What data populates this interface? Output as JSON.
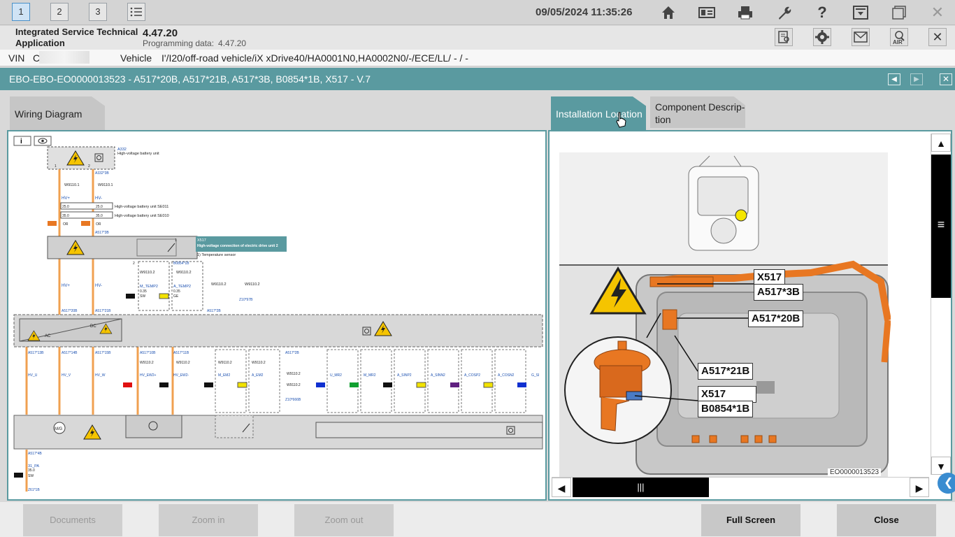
{
  "topbar": {
    "workspaces": [
      "1",
      "2",
      "3"
    ],
    "datetime": "09/05/2024 11:35:26",
    "icons": [
      "list-icon",
      "home-icon",
      "id-card-icon",
      "printer-icon",
      "wrench-icon",
      "help-icon",
      "download-tray-icon",
      "window-icon",
      "close-icon"
    ]
  },
  "app": {
    "name": "Integrated Service Technical Application",
    "version": "4.47.20",
    "programming_label": "Programming data:",
    "programming_version": "4.47.20"
  },
  "vehicle": {
    "vin_label": "VIN",
    "vin_value": "C",
    "vehicle_label": "Vehicle",
    "vehicle_value": "I'/I20/off-road vehicle/iX xDrive40/HA0001N0,HA0002N0/-/ECE/LL/ - / -"
  },
  "document": {
    "title": "EBO-EBO-EO0000013523 - A517*20B, A517*21B, A517*3B, B0854*1B, X517 - V.7"
  },
  "tabs": {
    "wiring": "Wiring Diagram",
    "install": "Installation Location",
    "component": "Component Descrip-tion"
  },
  "wiring": {
    "labels": {
      "a332": "A332",
      "a332_desc": "High-voltage battery unit",
      "x517": "X517",
      "x517_desc": "High-voltage connection of electric drive unit 2",
      "temp_note": "1)   Temperature sensor",
      "hv_plus": "HV+",
      "hv_minus": "HV-",
      "w9110_1": "W9110.1",
      "w9110_2": "W9110.2",
      "cable1": "High-voltage battery unit SE011",
      "cable2": "High-voltage battery unit SE010",
      "or": "OR",
      "sw": "SW",
      "ge": "GE",
      "ac": "AC",
      "dc": "DC"
    }
  },
  "install": {
    "callouts": {
      "x517_top": "X517",
      "a517_3b": "A517*3B",
      "a517_20b": "A517*20B",
      "a517_21b": "A517*21B",
      "x517_bottom": "X517",
      "b0854_1b": "B0854*1B"
    },
    "image_id": "EO0000013523"
  },
  "buttons": {
    "documents": "Documents",
    "zoom_in": "Zoom in",
    "zoom_out": "Zoom out",
    "full_screen": "Full Screen",
    "close": "Close"
  },
  "colors": {
    "accent": "#5a9aa0",
    "hv_orange": "#e87722"
  }
}
